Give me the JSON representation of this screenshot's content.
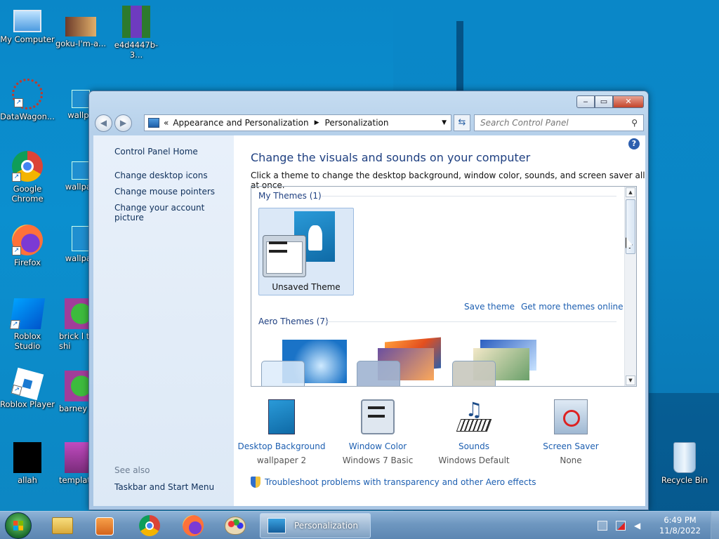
{
  "desktop": {
    "icons": [
      {
        "label": "My Computer",
        "icon": "computer-icon"
      },
      {
        "label": "goku-I'm-a...",
        "icon": "image-file-icon"
      },
      {
        "label": "e4d4447b-3...",
        "icon": "image-file-icon"
      },
      {
        "label": "DataWagon...",
        "icon": "datawagon-icon"
      },
      {
        "label": "wallpa",
        "icon": "image-file-icon"
      },
      {
        "label": "Google Chrome",
        "icon": "chrome-icon"
      },
      {
        "label": "wallpap",
        "icon": "image-file-icon"
      },
      {
        "label": "Firefox",
        "icon": "firefox-icon"
      },
      {
        "label": "wallpap",
        "icon": "image-file-icon"
      },
      {
        "label": "Roblox Studio",
        "icon": "roblox-studio-icon"
      },
      {
        "label": "brick l t-shi",
        "icon": "image-file-icon"
      },
      {
        "label": "Roblox Player",
        "icon": "roblox-player-icon"
      },
      {
        "label": "barney",
        "icon": "image-file-icon"
      },
      {
        "label": "allah",
        "icon": "image-file-icon"
      },
      {
        "label": "template",
        "icon": "image-file-icon"
      },
      {
        "label": "Recycle Bin",
        "icon": "recycle-bin-icon"
      }
    ]
  },
  "window": {
    "controls": {
      "minimize": "‒",
      "maximize": "▭",
      "close": "✕"
    },
    "address": {
      "prefix": "«",
      "crumb1": "Appearance and Personalization",
      "crumb2": "Personalization"
    },
    "search": {
      "placeholder": "Search Control Panel"
    },
    "left_pane": {
      "home": "Control Panel Home",
      "links": [
        "Change desktop icons",
        "Change mouse pointers",
        "Change your account picture"
      ],
      "see_also": "See also",
      "taskbar_link": "Taskbar and Start Menu"
    },
    "main": {
      "title": "Change the visuals and sounds on your computer",
      "subtitle": "Click a theme to change the desktop background, window color, sounds, and screen saver all at once.",
      "my_themes": "My Themes (1)",
      "unsaved_theme": "Unsaved Theme",
      "save_theme": "Save theme",
      "get_more": "Get more themes online",
      "aero_themes": "Aero Themes (7)",
      "bottom": [
        {
          "title": "Desktop Background",
          "value": "wallpaper 2"
        },
        {
          "title": "Window Color",
          "value": "Windows 7 Basic"
        },
        {
          "title": "Sounds",
          "value": "Windows Default"
        },
        {
          "title": "Screen Saver",
          "value": "None"
        }
      ],
      "troubleshoot": "Troubleshoot problems with transparency and other Aero effects"
    }
  },
  "taskbar": {
    "active_window": "Personalization",
    "time": "6:49 PM",
    "date": "11/8/2022"
  }
}
